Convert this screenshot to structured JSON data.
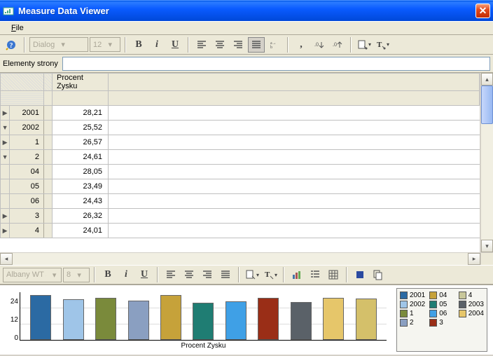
{
  "window": {
    "title": "Measure Data Viewer"
  },
  "menubar": {
    "file": "File"
  },
  "toolbar1": {
    "font_name": "Dialog",
    "font_size": "12"
  },
  "toolbar2": {
    "font_name": "Albany WT J",
    "font_size": "8"
  },
  "elements_bar": {
    "label": "Elementy strony"
  },
  "grid": {
    "col_header": "Procent Zysku",
    "rows": [
      {
        "tri": "▶",
        "label": "2001",
        "value": "28,21"
      },
      {
        "tri": "▼",
        "label": "2002",
        "value": "25,52"
      },
      {
        "tri": "▶",
        "label": "1",
        "value": "26,57"
      },
      {
        "tri": "▼",
        "label": "2",
        "value": "24,61"
      },
      {
        "tri": "",
        "label": "04",
        "value": "28,05"
      },
      {
        "tri": "",
        "label": "05",
        "value": "23,49"
      },
      {
        "tri": "",
        "label": "06",
        "value": "24,43"
      },
      {
        "tri": "▶",
        "label": "3",
        "value": "26,32"
      },
      {
        "tri": "▶",
        "label": "4",
        "value": "24,01"
      }
    ]
  },
  "chart_data": {
    "type": "bar",
    "title": "",
    "xlabel": "Procent Zysku",
    "ylabel": "",
    "ylim": [
      0,
      30
    ],
    "yticks": [
      12,
      24
    ],
    "categories": [
      "2001",
      "2002",
      "1",
      "2",
      "04",
      "05",
      "06",
      "3",
      "4",
      "2003",
      "2004"
    ],
    "values": [
      28.21,
      25.52,
      26.57,
      24.61,
      28.05,
      23.49,
      24.43,
      26.32,
      24.01,
      26.5,
      26.0
    ],
    "colors": [
      "#2b6aa3",
      "#9fc5e8",
      "#7a8a3b",
      "#8a9fc1",
      "#c6a23a",
      "#1f7d73",
      "#3fa0e6",
      "#9a2e17",
      "#5a6168",
      "#e6c66a",
      "#d4c06a"
    ],
    "legend": [
      {
        "label": "2001",
        "color": "#2b6aa3"
      },
      {
        "label": "04",
        "color": "#c6a23a"
      },
      {
        "label": "4",
        "color": "#c8c79a"
      },
      {
        "label": "2002",
        "color": "#9fc5e8"
      },
      {
        "label": "05",
        "color": "#1f7d73"
      },
      {
        "label": "2003",
        "color": "#5a6168"
      },
      {
        "label": "1",
        "color": "#7a8a3b"
      },
      {
        "label": "06",
        "color": "#3fa0e6"
      },
      {
        "label": "2004",
        "color": "#e6c66a"
      },
      {
        "label": "2",
        "color": "#8a9fc1"
      },
      {
        "label": "3",
        "color": "#9a2e17"
      }
    ]
  }
}
